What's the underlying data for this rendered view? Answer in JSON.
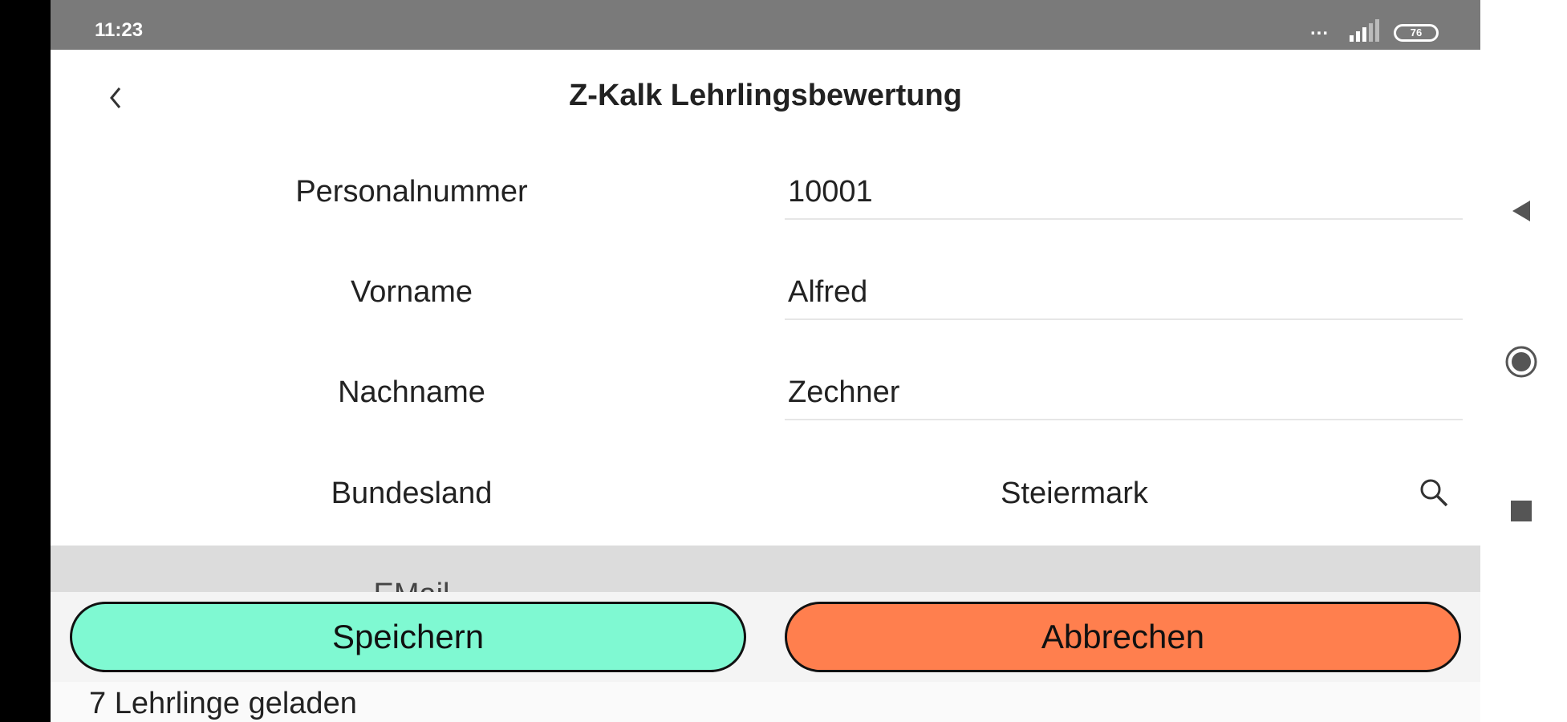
{
  "status_bar": {
    "time": "11:23",
    "dots": "...",
    "battery": "76"
  },
  "header": {
    "title": "Z-Kalk Lehrlingsbewertung",
    "back_icon": "chevron-left-icon"
  },
  "form": {
    "personalnummer": {
      "label": "Personalnummer",
      "value": "10001"
    },
    "vorname": {
      "label": "Vorname",
      "value": "Alfred"
    },
    "nachname": {
      "label": "Nachname",
      "value": "Zechner"
    },
    "bundesland": {
      "label": "Bundesland",
      "value": "Steiermark",
      "icon": "search-icon"
    },
    "email": {
      "label": "EMail"
    }
  },
  "buttons": {
    "save_label": "Speichern",
    "cancel_label": "Abbrechen",
    "save_color": "#7ff9d2",
    "cancel_color": "#ff7f4e"
  },
  "footer": {
    "status_text": "7 Lehrlinge geladen"
  },
  "system_nav": {
    "back_icon": "triangle-back-icon",
    "home_icon": "circle-home-icon",
    "recent_icon": "square-recent-icon"
  }
}
